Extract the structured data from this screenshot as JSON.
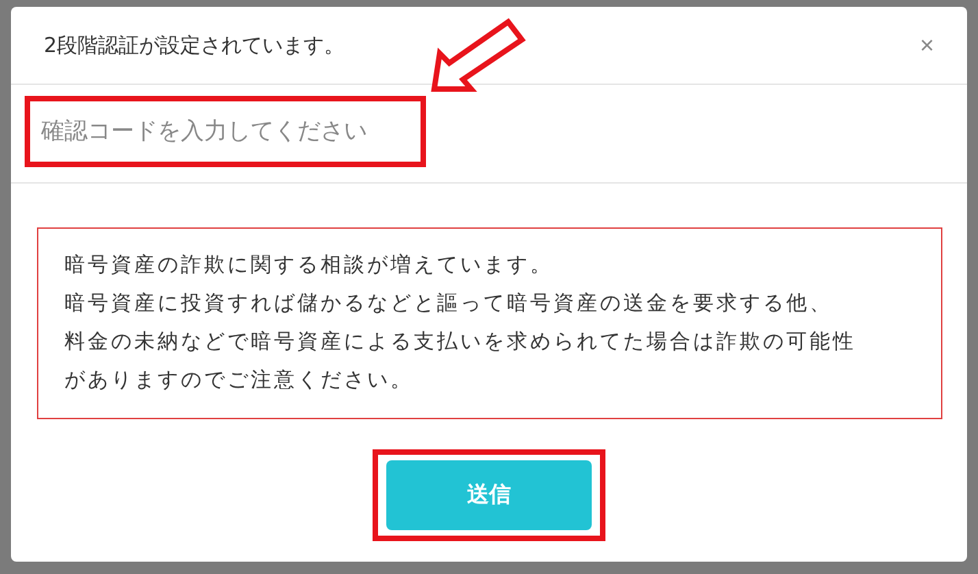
{
  "dialog": {
    "title": "2段階認証が設定されています。",
    "close": "×",
    "code_field": {
      "placeholder": "確認コードを入力してください"
    },
    "warning": [
      "暗号資産の詐欺に関する相談が増えています。",
      "暗号資産に投資すれば儲かるなどと謳って暗号資産の送金を要求する他、",
      "料金の未納などで暗号資産による支払いを求められてた場合は詐欺の可能性がありますのでご注意ください。"
    ],
    "submit": "送信"
  }
}
